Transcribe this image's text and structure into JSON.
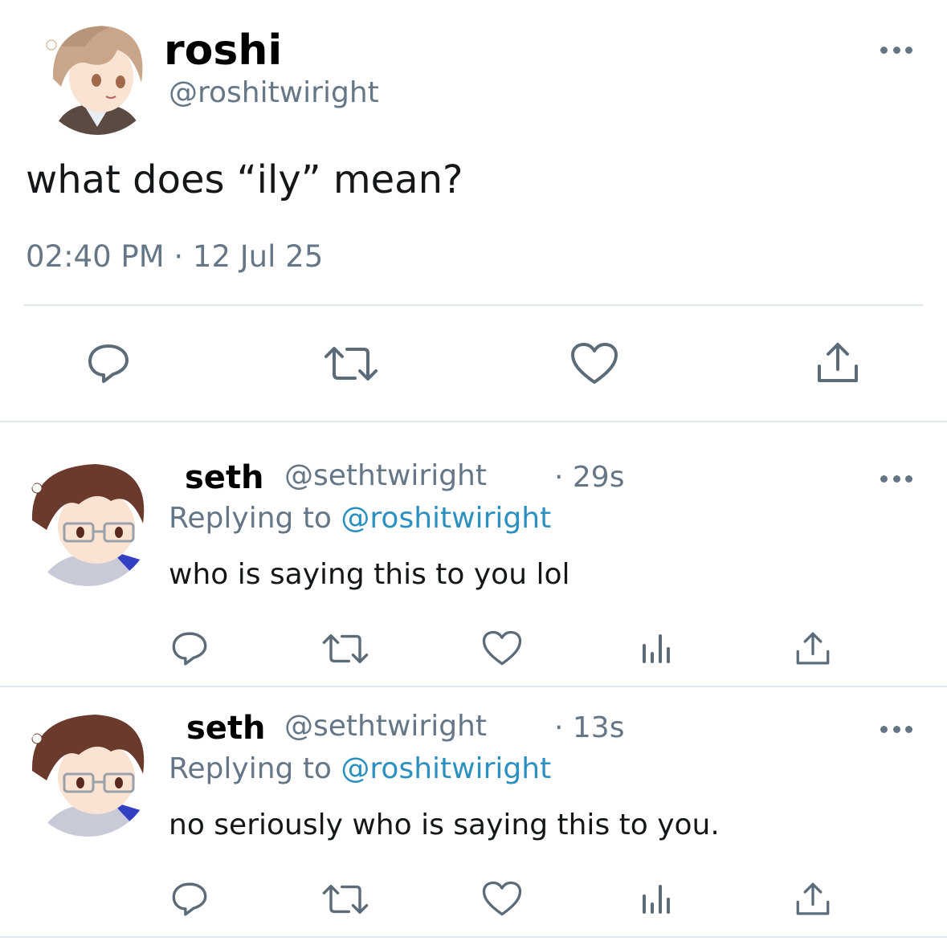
{
  "main_tweet": {
    "name": "roshi",
    "handle": "@roshitwiright",
    "text": "what does “ily” mean?",
    "timestamp": "02:40 PM · 12 Jul 25",
    "avatar_icon": "avatar-light-brown-hair",
    "actions": [
      "reply-icon",
      "retweet-icon",
      "like-icon",
      "share-icon"
    ]
  },
  "replies": [
    {
      "name": "seth",
      "handle": "@sethtwiright",
      "time": "· 29s",
      "replying_prefix": "Replying to",
      "replying_mention": "@roshitwiright",
      "text": "who is saying this to you lol",
      "avatar_icon": "avatar-dark-brown-hair-glasses",
      "actions": [
        "reply-icon",
        "retweet-icon",
        "like-icon",
        "analytics-icon",
        "share-icon"
      ]
    },
    {
      "name": "seth",
      "handle": "@sethtwiright",
      "time": "· 13s",
      "replying_prefix": "Replying to",
      "replying_mention": "@roshitwiright",
      "text": "no seriously who is saying this to you.",
      "avatar_icon": "avatar-dark-brown-hair-glasses",
      "actions": [
        "reply-icon",
        "retweet-icon",
        "like-icon",
        "analytics-icon",
        "share-icon"
      ]
    }
  ],
  "colors": {
    "secondary_text": "#657786",
    "link": "#2b8fc0",
    "divider": "#e1e8ed",
    "icon": "#5b6b78"
  }
}
